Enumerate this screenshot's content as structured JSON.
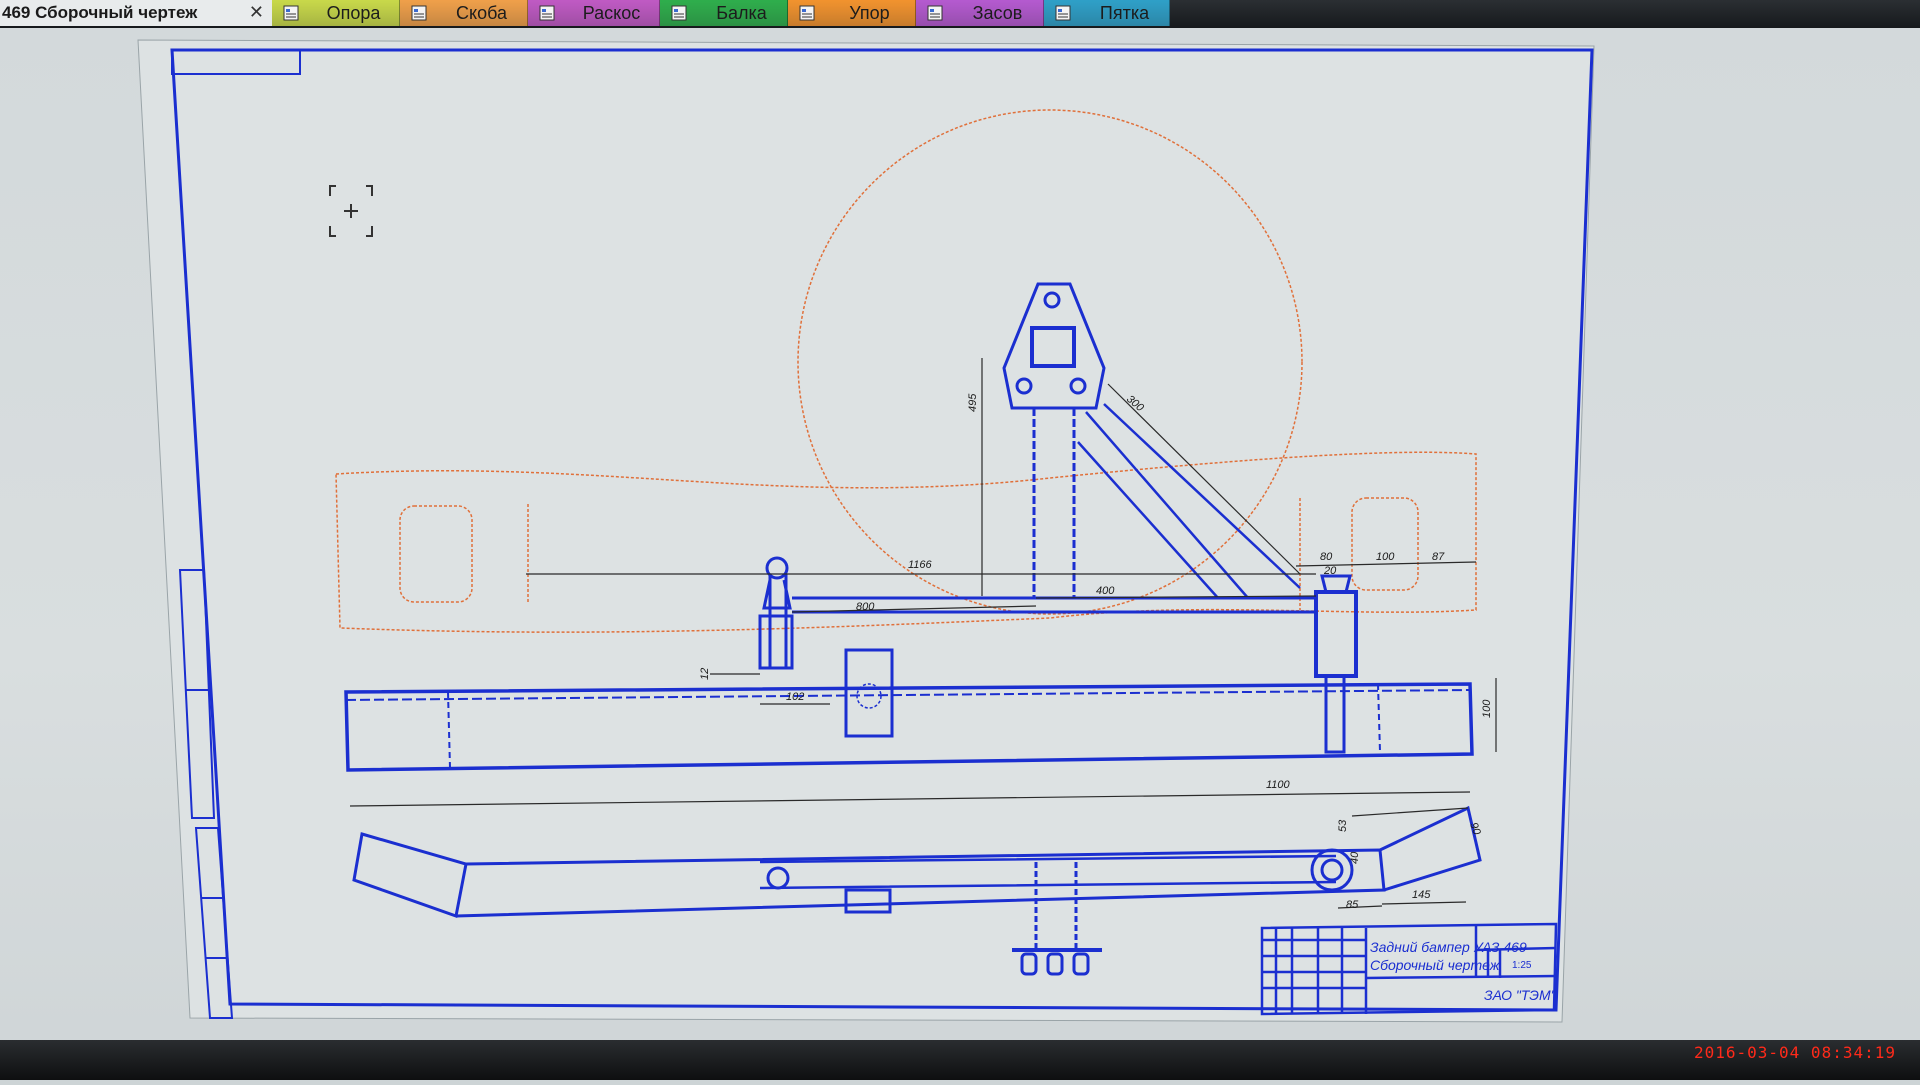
{
  "active_document": {
    "title": "469 Сборочный чертеж",
    "close_symbol": "✕"
  },
  "tabs": [
    {
      "label": "Опора",
      "color": "#c9d94a"
    },
    {
      "label": "Скоба",
      "color": "#f0a04a"
    },
    {
      "label": "Раскос",
      "color": "#c05ac4"
    },
    {
      "label": "Балка",
      "color": "#2fae4c"
    },
    {
      "label": "Упор",
      "color": "#f2932e"
    },
    {
      "label": "Засов",
      "color": "#b55ad0"
    },
    {
      "label": "Пятка",
      "color": "#2fa0c8"
    }
  ],
  "drawing": {
    "dimensions": {
      "d1166": "1166",
      "d800": "800",
      "d400": "400",
      "d80": "80",
      "d20": "20",
      "d100a": "100",
      "d87": "87",
      "d495": "495",
      "d300": "300",
      "d102": "102",
      "d100b": "100",
      "d1100": "1100",
      "d53": "53",
      "d40": "40",
      "d85": "85",
      "d145": "145",
      "d90": "90",
      "d12": "12"
    },
    "title_block": {
      "name_line1": "Задний бампер УАЗ 469",
      "name_line2": "Сборочный чертеж",
      "company": "ЗАО \"ТЭМ\"",
      "scale": "1:25"
    }
  },
  "colors": {
    "line_blue": "#1b2fd0",
    "guide_orange": "#e0703a",
    "paper": "#d9dfe0",
    "timestamp_red": "#ff2a1a"
  },
  "icons": {
    "tab_icon": "document-icon",
    "crosshair": "crosshair-icon",
    "close": "close-icon"
  },
  "status": {
    "timestamp": "2016-03-04 08:34:19"
  }
}
